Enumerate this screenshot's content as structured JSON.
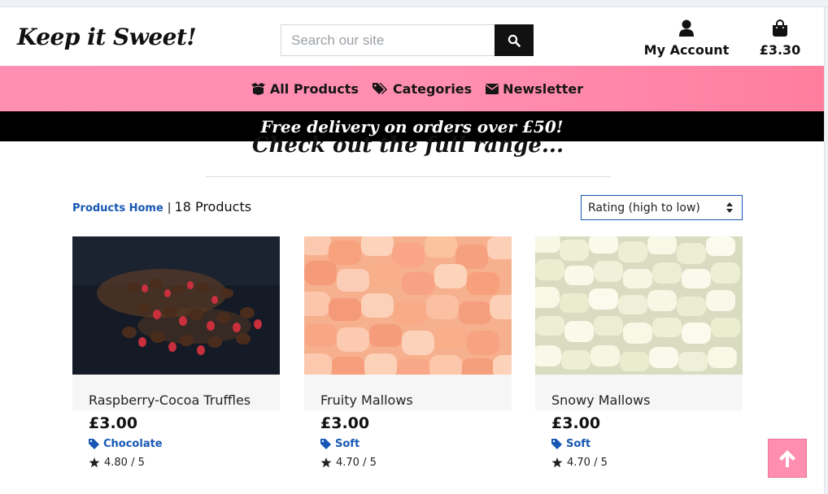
{
  "brand": {
    "logo_text": "Keep it Sweet!"
  },
  "search": {
    "placeholder": "Search our site",
    "button_icon": "magnifier-icon"
  },
  "header": {
    "account_label": "My Account",
    "account_icon": "user-icon",
    "cart_total": "£3.30",
    "cart_icon": "shopping-bag-icon"
  },
  "nav": {
    "items": [
      {
        "label": "All Products",
        "icon": "box-open-icon"
      },
      {
        "label": "Categories",
        "icon": "tags-icon"
      },
      {
        "label": "Newsletter",
        "icon": "envelope-icon"
      }
    ]
  },
  "promo": {
    "text": "Free delivery on orders over £50!"
  },
  "main": {
    "title": "Check out the full range...",
    "breadcrumb": {
      "home_link": "Products Home",
      "separator": "|",
      "count": "18 Products"
    },
    "sort": {
      "selected": "Rating (high to low)"
    }
  },
  "products": [
    {
      "name": "Raspberry-Cocoa Truffles",
      "price": "£3.00",
      "category": "Chocolate",
      "rating": "4.80 / 5"
    },
    {
      "name": "Fruity Mallows",
      "price": "£3.00",
      "category": "Soft",
      "rating": "4.70 / 5"
    },
    {
      "name": "Snowy Mallows",
      "price": "£3.00",
      "category": "Soft",
      "rating": "4.70 / 5"
    }
  ],
  "colors": {
    "nav_pink": "#ff8eb1",
    "link_blue": "#1657b4",
    "promo_black": "#000000"
  },
  "back_to_top": {
    "icon": "arrow-up-icon"
  }
}
